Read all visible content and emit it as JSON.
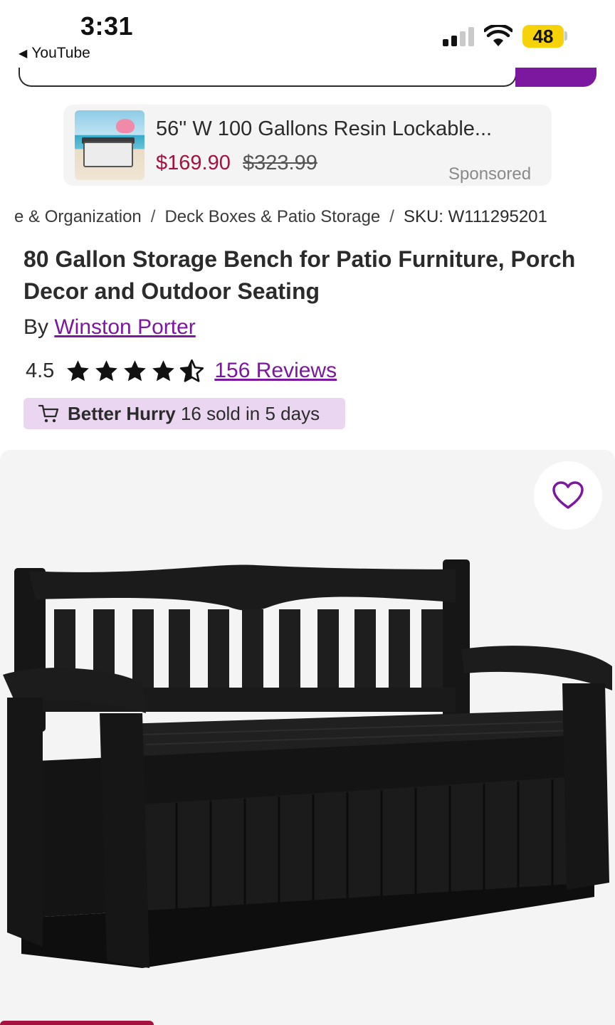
{
  "status_bar": {
    "time": "3:31",
    "back_app": "YouTube",
    "battery": "48",
    "icons": [
      "signal-icon",
      "wifi-icon",
      "battery-icon"
    ]
  },
  "sponsored": {
    "title": "56'' W 100 Gallons Resin Lockable...",
    "price": "$169.90",
    "old_price": "$323.99",
    "label": "Sponsored"
  },
  "breadcrumb": {
    "items": [
      "e & Organization",
      "Deck Boxes & Patio Storage"
    ],
    "separator": "/",
    "sku": "SKU: W111295201"
  },
  "product": {
    "title": "80 Gallon Storage Bench for Patio Furniture, Porch Decor and Outdoor Seating",
    "by_prefix": "By",
    "brand": "Winston Porter",
    "rating": "4.5",
    "stars": 4.5,
    "reviews": "156 Reviews",
    "hurry_bold": "Better Hurry",
    "hurry_text": "16 sold in 5 days"
  },
  "colors": {
    "accent": "#7b189f",
    "sale": "#a5123f",
    "badge_bg": "#ebd6f1",
    "battery": "#f5d20a"
  }
}
